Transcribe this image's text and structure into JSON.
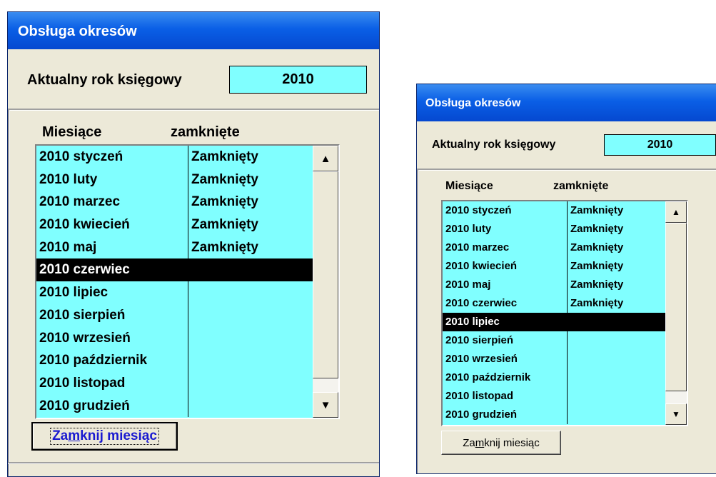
{
  "left_window": {
    "title": "Obsługa okresów",
    "year_label": "Aktualny rok księgowy",
    "year_value": "2010",
    "col_months": "Miesiące",
    "col_closed": "zamknięte",
    "rows": [
      {
        "month": "2010 styczeń",
        "status": "Zamknięty"
      },
      {
        "month": "2010 luty",
        "status": "Zamknięty"
      },
      {
        "month": "2010 marzec",
        "status": "Zamknięty"
      },
      {
        "month": "2010 kwiecień",
        "status": "Zamknięty"
      },
      {
        "month": "2010 maj",
        "status": "Zamknięty"
      },
      {
        "month": "2010 czerwiec",
        "status": ""
      },
      {
        "month": "2010 lipiec",
        "status": ""
      },
      {
        "month": "2010 sierpień",
        "status": ""
      },
      {
        "month": "2010 wrzesień",
        "status": ""
      },
      {
        "month": "2010 październik",
        "status": ""
      },
      {
        "month": "2010 listopad",
        "status": ""
      },
      {
        "month": "2010 grudzień",
        "status": ""
      }
    ],
    "selected_index": 5,
    "button": {
      "pre": "Za",
      "mnemonic": "m",
      "post": "knij miesiąc"
    }
  },
  "right_window": {
    "title": "Obsługa okresów",
    "year_label": "Aktualny rok księgowy",
    "year_value": "2010",
    "col_months": "Miesiące",
    "col_closed": "zamknięte",
    "rows": [
      {
        "month": "2010 styczeń",
        "status": "Zamknięty"
      },
      {
        "month": "2010 luty",
        "status": "Zamknięty"
      },
      {
        "month": "2010 marzec",
        "status": "Zamknięty"
      },
      {
        "month": "2010 kwiecień",
        "status": "Zamknięty"
      },
      {
        "month": "2010 maj",
        "status": "Zamknięty"
      },
      {
        "month": "2010 czerwiec",
        "status": "Zamknięty"
      },
      {
        "month": "2010 lipiec",
        "status": ""
      },
      {
        "month": "2010 sierpień",
        "status": ""
      },
      {
        "month": "2010 wrzesień",
        "status": ""
      },
      {
        "month": "2010 październik",
        "status": ""
      },
      {
        "month": "2010 listopad",
        "status": ""
      },
      {
        "month": "2010 grudzień",
        "status": ""
      }
    ],
    "selected_index": 6,
    "button": {
      "pre": "Za",
      "mnemonic": "m",
      "post": "knij miesiąc"
    }
  },
  "icons": {
    "scroll_up": "▲",
    "scroll_down": "▼"
  },
  "colors": {
    "field_bg": "#80ffff",
    "titlebar": "#0a5fe6",
    "window_bg": "#ece9d8"
  }
}
